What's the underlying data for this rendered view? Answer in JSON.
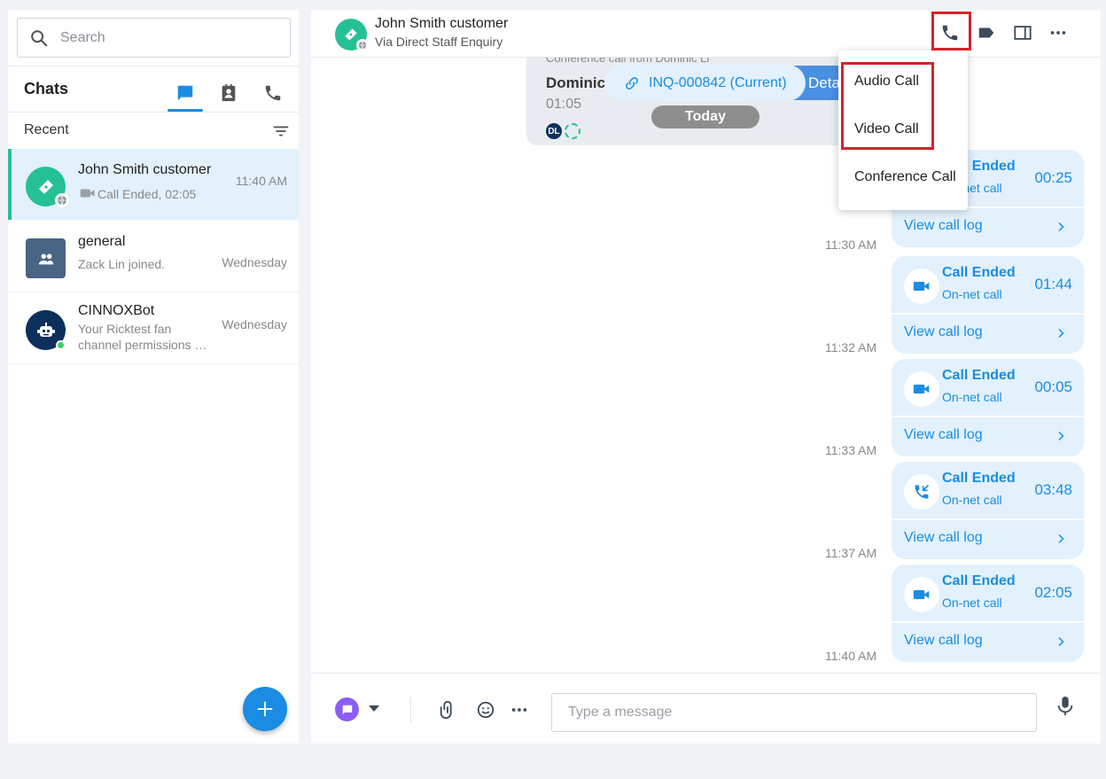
{
  "search": {
    "placeholder": "Search"
  },
  "sidebar": {
    "title": "Chats",
    "section_label": "Recent",
    "tabs": [
      "chat-bubble-icon",
      "contacts-icon",
      "phone-icon"
    ],
    "conversations": [
      {
        "name": "John Smith customer",
        "preview": "Call Ended, 02:05",
        "time": "11:40 AM",
        "active": true
      },
      {
        "name": "general",
        "preview": "Zack Lin joined.",
        "time": "Wednesday"
      },
      {
        "name": "CINNOXBot",
        "preview_line1": "Your Ricktest fan",
        "preview_line2": "channel permissions …",
        "time": "Wednesday"
      }
    ]
  },
  "chat": {
    "contact_name": "John Smith customer",
    "contact_sub": "Via Direct Staff Enquiry",
    "conference": {
      "title": "Conference call from Dominic Li",
      "name": "Dominic",
      "duration": "01:05",
      "details_label": "Deta",
      "badge_initials": "DL"
    },
    "inquiry_label": "INQ-000842 (Current)",
    "date_divider": "Today",
    "call_menu": [
      "Audio Call",
      "Video Call",
      "Conference Call"
    ],
    "call_logs": [
      {
        "title": "Call Ended",
        "sub": "On-net call",
        "duration": "00:25",
        "link": "View call log",
        "time": "11:30 AM",
        "kind": "video"
      },
      {
        "title": "Call Ended",
        "sub": "On-net call",
        "duration": "01:44",
        "link": "View call log",
        "time": "11:32 AM",
        "kind": "video"
      },
      {
        "title": "Call Ended",
        "sub": "On-net call",
        "duration": "00:05",
        "link": "View call log",
        "time": "11:33 AM",
        "kind": "video"
      },
      {
        "title": "Call Ended",
        "sub": "On-net call",
        "duration": "03:48",
        "link": "View call log",
        "time": "11:37 AM",
        "kind": "audio"
      },
      {
        "title": "Call Ended",
        "sub": "On-net call",
        "duration": "02:05",
        "link": "View call log",
        "time": "11:40 AM",
        "kind": "video"
      }
    ]
  },
  "composer": {
    "placeholder": "Type a message"
  },
  "colors": {
    "accent": "#1a8ce3",
    "green": "#25c194",
    "highlight": "#d3242b",
    "bubble": "#e2f1fc"
  }
}
